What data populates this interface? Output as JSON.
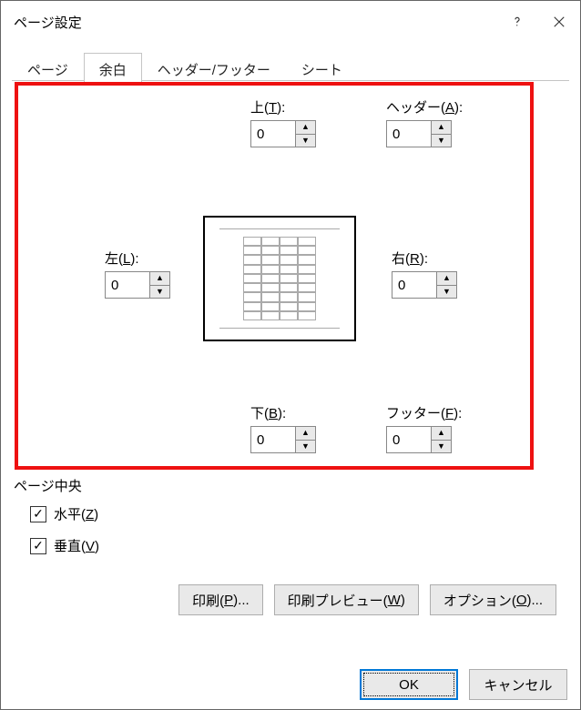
{
  "titlebar": {
    "title": "ページ設定"
  },
  "tabs": {
    "items": [
      {
        "label": "ページ",
        "active": false
      },
      {
        "label": "余白",
        "active": true
      },
      {
        "label": "ヘッダー/フッター",
        "active": false
      },
      {
        "label": "シート",
        "active": false
      }
    ]
  },
  "margins": {
    "top": {
      "label_pre": "上(",
      "shortcut": "T",
      "label_post": "):",
      "value": "0"
    },
    "header": {
      "label_pre": "ヘッダー(",
      "shortcut": "A",
      "label_post": "):",
      "value": "0"
    },
    "left": {
      "label_pre": "左(",
      "shortcut": "L",
      "label_post": "):",
      "value": "0"
    },
    "right": {
      "label_pre": "右(",
      "shortcut": "R",
      "label_post": "):",
      "value": "0"
    },
    "bottom": {
      "label_pre": "下(",
      "shortcut": "B",
      "label_post": "):",
      "value": "0"
    },
    "footer": {
      "label_pre": "フッター(",
      "shortcut": "F",
      "label_post": "):",
      "value": "0"
    }
  },
  "center": {
    "legend": "ページ中央",
    "horizontal": {
      "label_pre": "水平(",
      "shortcut": "Z",
      "label_post": ")",
      "checked": true
    },
    "vertical": {
      "label_pre": "垂直(",
      "shortcut": "V",
      "label_post": ")",
      "checked": true
    }
  },
  "buttons": {
    "print": {
      "label_pre": "印刷(",
      "shortcut": "P",
      "label_post": ")..."
    },
    "preview": {
      "label_pre": "印刷プレビュー(",
      "shortcut": "W",
      "label_post": ")"
    },
    "options": {
      "label_pre": "オプション(",
      "shortcut": "O",
      "label_post": ")..."
    },
    "ok": "OK",
    "cancel": "キャンセル"
  }
}
